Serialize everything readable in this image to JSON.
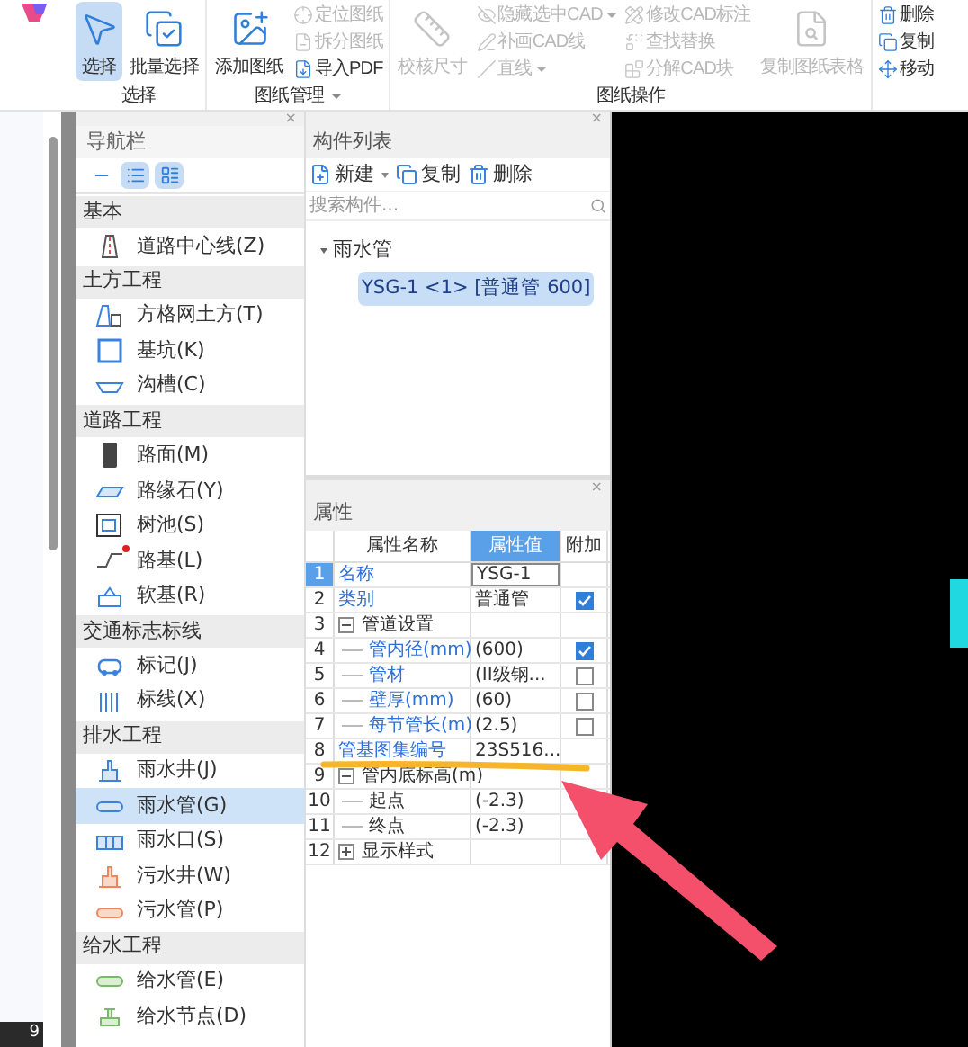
{
  "toolbar": {
    "groups": [
      {
        "label": "选择",
        "dropdown": false,
        "items": [
          {
            "kind": "large",
            "label": "选择",
            "selected": true,
            "disabled": false,
            "caret": false
          },
          {
            "kind": "large",
            "label": "批量选择",
            "selected": false,
            "disabled": false,
            "caret": false
          }
        ]
      },
      {
        "label": "图纸管理",
        "dropdown": true,
        "items": [
          {
            "kind": "large",
            "label": "添加图纸",
            "selected": false,
            "disabled": false,
            "caret": false
          },
          {
            "kind": "small",
            "label": "定位图纸",
            "selected": false,
            "disabled": true,
            "caret": false
          },
          {
            "kind": "small",
            "label": "拆分图纸",
            "selected": false,
            "disabled": true,
            "caret": false
          },
          {
            "kind": "small",
            "label": "导入PDF",
            "selected": false,
            "disabled": false,
            "caret": false
          }
        ]
      },
      {
        "label": "图纸操作",
        "dropdown": false,
        "items": [
          {
            "kind": "large",
            "label": "校核尺寸",
            "selected": false,
            "disabled": true,
            "caret": false
          },
          {
            "kind": "small",
            "label": "隐藏选中CAD",
            "selected": false,
            "disabled": true,
            "caret": true
          },
          {
            "kind": "small",
            "label": "补画CAD线",
            "selected": false,
            "disabled": true,
            "caret": false
          },
          {
            "kind": "small",
            "label": "直线",
            "selected": false,
            "disabled": true,
            "caret": true
          },
          {
            "kind": "small",
            "label": "修改CAD标注",
            "selected": false,
            "disabled": true,
            "caret": false
          },
          {
            "kind": "small",
            "label": "查找替换",
            "selected": false,
            "disabled": true,
            "caret": false
          },
          {
            "kind": "small",
            "label": "分解CAD块",
            "selected": false,
            "disabled": true,
            "caret": false
          },
          {
            "kind": "large",
            "label": "复制图纸表格",
            "selected": false,
            "disabled": true,
            "caret": false
          }
        ]
      },
      {
        "dropdown": false,
        "items": [
          {
            "kind": "small",
            "label": "删除",
            "selected": false,
            "disabled": false,
            "caret": false
          },
          {
            "kind": "small",
            "label": "复制",
            "selected": false,
            "disabled": false,
            "caret": false
          },
          {
            "kind": "small",
            "label": "移动",
            "selected": false,
            "disabled": false,
            "caret": false
          }
        ]
      }
    ]
  },
  "nav": {
    "close": "×",
    "title": "导航栏",
    "views": [
      {
        "selected": false
      },
      {
        "selected": true
      },
      {
        "selected": true
      }
    ],
    "sections": [
      {
        "title": "基本",
        "items": [
          {
            "label": "道路中心线(Z)",
            "selected": false,
            "notified": false
          }
        ]
      },
      {
        "title": "土方工程",
        "items": [
          {
            "label": "方格网土方(T)",
            "selected": false,
            "notified": false
          },
          {
            "label": "基坑(K)",
            "selected": false,
            "notified": false
          },
          {
            "label": "沟槽(C)",
            "selected": false,
            "notified": false
          }
        ]
      },
      {
        "title": "道路工程",
        "items": [
          {
            "label": "路面(M)",
            "selected": false,
            "notified": false
          },
          {
            "label": "路缘石(Y)",
            "selected": false,
            "notified": false
          },
          {
            "label": "树池(S)",
            "selected": false,
            "notified": false
          },
          {
            "label": "路基(L)",
            "selected": false,
            "notified": true
          },
          {
            "label": "软基(R)",
            "selected": false,
            "notified": false
          }
        ]
      },
      {
        "title": "交通标志标线",
        "items": [
          {
            "label": "标记(J)",
            "selected": false,
            "notified": false
          },
          {
            "label": "标线(X)",
            "selected": false,
            "notified": false
          }
        ]
      },
      {
        "title": "排水工程",
        "items": [
          {
            "label": "雨水井(J)",
            "selected": false,
            "notified": false
          },
          {
            "label": "雨水管(G)",
            "selected": true,
            "notified": false
          },
          {
            "label": "雨水口(S)",
            "selected": false,
            "notified": false
          },
          {
            "label": "污水井(W)",
            "selected": false,
            "notified": false
          },
          {
            "label": "污水管(P)",
            "selected": false,
            "notified": false
          }
        ]
      },
      {
        "title": "给水工程",
        "items": [
          {
            "label": "给水管(E)",
            "selected": false,
            "notified": false
          },
          {
            "label": "给水节点(D)",
            "selected": false,
            "notified": false
          }
        ]
      }
    ]
  },
  "components": {
    "close": "×",
    "title": "构件列表",
    "actions": [
      {
        "label": "新建",
        "caret": true
      },
      {
        "label": "复制",
        "caret": false
      },
      {
        "label": "删除",
        "caret": false
      }
    ],
    "search": {
      "placeholder": "搜索构件..."
    },
    "tree": [
      {
        "label": "雨水管",
        "expanded": true,
        "selected": false,
        "children": [
          {
            "label": "YSG-1 <1> [普通管 600]",
            "selected": true
          }
        ]
      }
    ]
  },
  "properties": {
    "close": "×",
    "title": "属性",
    "columns": [
      {
        "label": "属性名称",
        "selected": false
      },
      {
        "label": "属性值",
        "selected": true
      },
      {
        "label": "附加",
        "selected": false
      }
    ],
    "rows": [
      {
        "num": "1",
        "name": "名称",
        "value": "YSG-1",
        "linked": true,
        "selected": true
      },
      {
        "num": "2",
        "name": "类别",
        "value": "普通管",
        "linked": true,
        "selected": false,
        "extra": {
          "checked": true
        }
      },
      {
        "num": "3",
        "name": "管道设置",
        "linked": false,
        "selected": false,
        "expanded": true,
        "children": [
          {
            "num": "4",
            "name": "管内径(mm)",
            "value": "(600)",
            "linked": true,
            "selected": false,
            "extra": {
              "checked": true
            }
          },
          {
            "num": "5",
            "name": "管材",
            "value": "(II级钢...",
            "linked": true,
            "selected": false,
            "extra": {
              "checked": false
            }
          },
          {
            "num": "6",
            "name": "壁厚(mm)",
            "value": "(60)",
            "linked": true,
            "selected": false,
            "extra": {
              "checked": false
            }
          },
          {
            "num": "7",
            "name": "每节管长(m)",
            "value": "(2.5)",
            "linked": true,
            "selected": false,
            "extra": {
              "checked": false
            }
          }
        ]
      },
      {
        "num": "8",
        "name": "管基图集编号",
        "value": "23S516...",
        "linked": true,
        "selected": false
      },
      {
        "num": "9",
        "name": "管内底标高(m)",
        "linked": false,
        "selected": false,
        "expanded": true,
        "children": [
          {
            "num": "10",
            "name": "起点",
            "value": "(-2.3)",
            "linked": false,
            "selected": false
          },
          {
            "num": "11",
            "name": "终点",
            "value": "(-2.3)",
            "linked": false,
            "selected": false
          }
        ]
      },
      {
        "num": "12",
        "name": "显示样式",
        "linked": false,
        "selected": false,
        "expanded": false
      }
    ]
  },
  "status": {
    "text": "9"
  },
  "annotations": [
    {
      "kind": "underline",
      "color": "#f7b52c"
    },
    {
      "kind": "arrow",
      "color": "#f4506c"
    }
  ]
}
